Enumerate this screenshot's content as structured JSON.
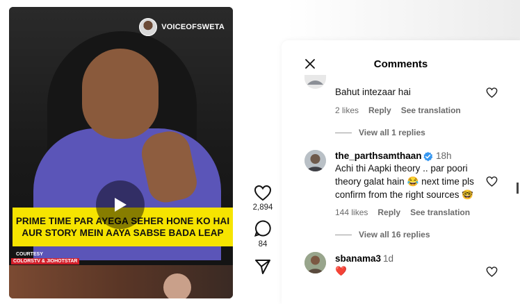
{
  "video": {
    "channel_name": "VOICEOFSWETA",
    "caption_line1": "PRIME TIME PAR AYEGA SEHER HONE KO HAI",
    "caption_line2": "AUR STORY MEIN AAYA SABSE BADA LEAP",
    "courtesy_label": "COURTESY",
    "courtesy_source": "COLORSTV & JIOHOTSTAR",
    "caption_color": "#f6e400"
  },
  "actions": {
    "like_icon": "heart-icon",
    "like_count": "2,894",
    "comment_icon": "comment-bubble-icon",
    "comment_count": "84",
    "share_icon": "paper-plane-icon"
  },
  "comments_panel": {
    "title": "Comments",
    "comments": [
      {
        "text": "Bahut intezaar hai",
        "likes": "2 likes",
        "reply_label": "Reply",
        "translate_label": "See translation",
        "view_replies": "View all 1 replies"
      },
      {
        "username": "the_parthsamthaan",
        "verified": true,
        "time": "18h",
        "text_line1": "Achi thi Aapki theory .. par poori",
        "text_line2": "theory galat hain 😂  next time pls",
        "text_line3": "confirm from the right sources 🤓",
        "likes": "144 likes",
        "reply_label": "Reply",
        "translate_label": "See translation",
        "view_replies": "View all 16 replies"
      },
      {
        "username": "sbanama3",
        "time": "1d",
        "text": "❤️"
      }
    ]
  },
  "colors": {
    "verified_badge": "#3797f0",
    "secondary_text": "#6b6b6b"
  }
}
